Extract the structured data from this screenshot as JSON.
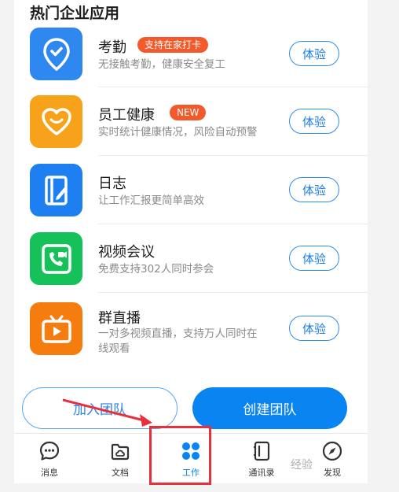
{
  "section_title": "热门企业应用",
  "apps": [
    {
      "name": "考勤",
      "badge": "支持在家打卡",
      "desc_lines": [
        "无接触考勤，健康安全复工"
      ],
      "button": "体验",
      "icon": "location-check-icon",
      "color": "#2f88f0"
    },
    {
      "name": "员工健康",
      "badge": "NEW",
      "desc_lines": [
        "实时统计健康情况，风险自动预警"
      ],
      "button": "体验",
      "icon": "heart-icon",
      "color": "#f7a21b"
    },
    {
      "name": "日志",
      "badge": "",
      "desc_lines": [
        "让工作汇报更简单高效"
      ],
      "button": "体验",
      "icon": "notebook-pen-icon",
      "color": "#1e7ff0"
    },
    {
      "name": "视频会议",
      "badge": "",
      "desc_lines": [
        "免费支持302人同时参会"
      ],
      "button": "体验",
      "icon": "video-phone-icon",
      "color": "#16c15a"
    },
    {
      "name": "群直播",
      "badge": "",
      "desc_lines": [
        "一对多视频直播，支持万人同时在",
        "线观看"
      ],
      "button": "体验",
      "icon": "tv-play-icon",
      "color": "#f57d0f"
    }
  ],
  "actions": {
    "join": "加入团队",
    "create": "创建团队"
  },
  "tabs": [
    {
      "label": "消息",
      "icon": "chat-bubble-icon"
    },
    {
      "label": "文档",
      "icon": "cloud-folder-icon"
    },
    {
      "label": "工作",
      "icon": "grid-four-icon"
    },
    {
      "label": "通讯录",
      "icon": "contact-book-icon"
    },
    {
      "label": "发现",
      "icon": "compass-icon"
    }
  ],
  "watermark": "经验",
  "colors": {
    "accent": "#0a84f0",
    "highlight": "#e8303d"
  }
}
